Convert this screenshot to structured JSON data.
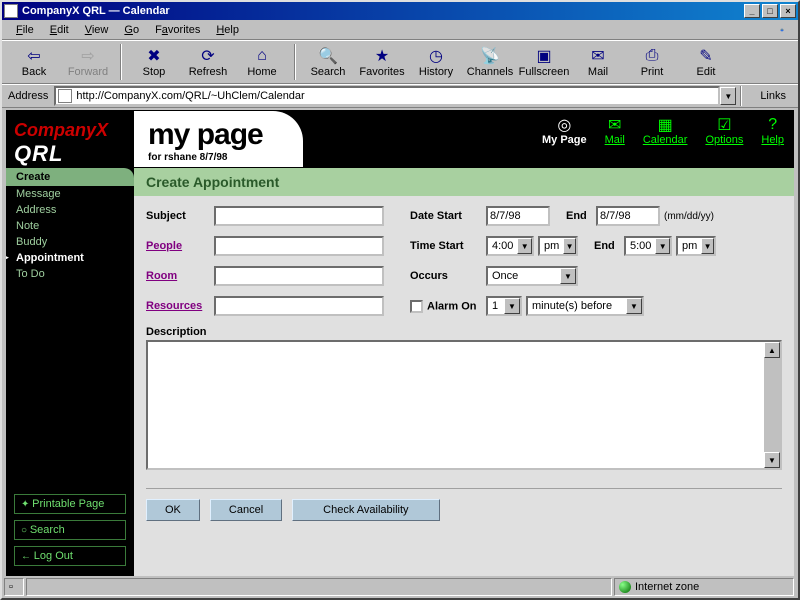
{
  "window": {
    "title": "CompanyX QRL — Calendar"
  },
  "menubar": {
    "file": "File",
    "edit": "Edit",
    "view": "View",
    "go": "Go",
    "favorites": "Favorites",
    "help": "Help"
  },
  "toolbar": {
    "back": "Back",
    "forward": "Forward",
    "stop": "Stop",
    "refresh": "Refresh",
    "home": "Home",
    "search": "Search",
    "favorites": "Favorites",
    "history": "History",
    "channels": "Channels",
    "fullscreen": "Fullscreen",
    "mail": "Mail",
    "print": "Print",
    "edit": "Edit"
  },
  "addressbar": {
    "label": "Address",
    "url": "http://CompanyX.com/QRL/~UhClem/Calendar",
    "links": "Links"
  },
  "brand": {
    "company": "CompanyX",
    "product": "QRL"
  },
  "sidenav": {
    "header": "Create",
    "items": [
      "Message",
      "Address",
      "Note",
      "Buddy",
      "Appointment",
      "To Do"
    ],
    "active_index": 4
  },
  "sideutil": {
    "printable": "Printable Page",
    "search": "Search",
    "logout": "Log Out"
  },
  "header": {
    "title": "my page",
    "subtitle": "for rshane 8/7/98",
    "nav": [
      {
        "label": "My Page",
        "icon": "◎"
      },
      {
        "label": "Mail",
        "icon": "✉"
      },
      {
        "label": "Calendar",
        "icon": "▦"
      },
      {
        "label": "Options",
        "icon": "☑"
      },
      {
        "label": "Help",
        "icon": "?"
      }
    ]
  },
  "form": {
    "title": "Create Appointment",
    "labels": {
      "subject": "Subject",
      "people": "People",
      "room": "Room",
      "resources": "Resources",
      "date_start": "Date Start",
      "end": "End",
      "time_start": "Time Start",
      "occurs": "Occurs",
      "alarm_on": "Alarm On",
      "description": "Description",
      "date_format": "(mm/dd/yy)"
    },
    "values": {
      "subject": "",
      "people": "",
      "room": "",
      "resources": "",
      "date_start": "8/7/98",
      "date_end": "8/7/98",
      "time_start": "4:00",
      "time_start_ampm": "pm",
      "time_end": "5:00",
      "time_end_ampm": "pm",
      "occurs": "Once",
      "alarm_checked": false,
      "alarm_count": "1",
      "alarm_unit": "minute(s) before"
    },
    "buttons": {
      "ok": "OK",
      "cancel": "Cancel",
      "check": "Check Availability"
    }
  },
  "statusbar": {
    "zone": "Internet zone"
  }
}
